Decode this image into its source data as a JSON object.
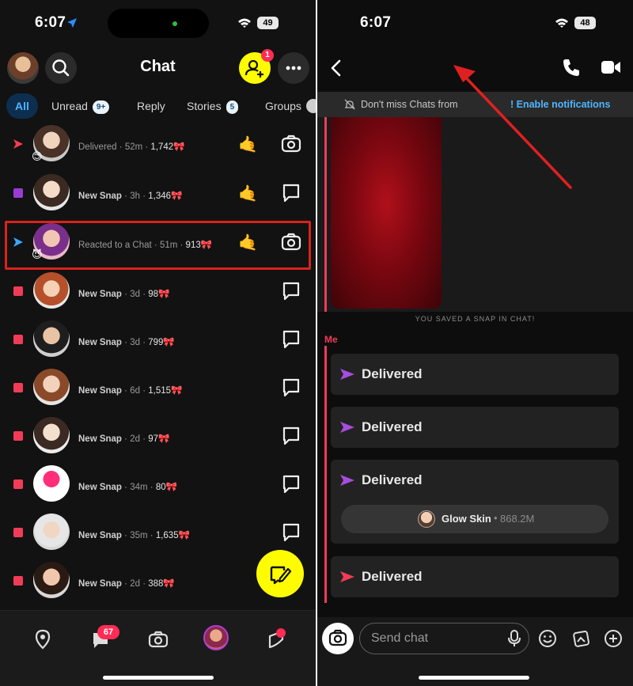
{
  "left": {
    "status": {
      "time": "6:07",
      "battery": "49"
    },
    "header": {
      "title": "Chat",
      "friend_requests_badge": "1"
    },
    "tabs": [
      {
        "label": "All",
        "count": ""
      },
      {
        "label": "Unread",
        "count": "9+"
      },
      {
        "label": "Reply",
        "count": ""
      },
      {
        "label": "Stories",
        "count": "5"
      },
      {
        "label": "Groups",
        "count": ""
      }
    ],
    "chats": [
      {
        "indicator": "sent-snap-red",
        "status": "Delivered",
        "time": "52m",
        "streak": "1,742🎀",
        "action": "camera-icon",
        "wave": true,
        "emoji_badge": "😊"
      },
      {
        "indicator": "new-snap-purple",
        "status": "New Snap",
        "time": "3h",
        "streak": "1,346🎀",
        "action": "chat-bubble-icon",
        "wave": true,
        "emoji_badge": ""
      },
      {
        "indicator": "sent-chat-blue",
        "status": "Reacted to a Chat",
        "time": "51m",
        "streak": "913🎀",
        "action": "camera-icon",
        "wave": true,
        "emoji_badge": "😈"
      },
      {
        "indicator": "new-snap-red",
        "status": "New Snap",
        "time": "3d",
        "streak": "98🎀",
        "action": "chat-bubble-icon",
        "wave": false,
        "emoji_badge": ""
      },
      {
        "indicator": "new-snap-red",
        "status": "New Snap",
        "time": "3d",
        "streak": "799🎀",
        "action": "chat-bubble-icon",
        "wave": false,
        "emoji_badge": ""
      },
      {
        "indicator": "new-snap-red",
        "status": "New Snap",
        "time": "6d",
        "streak": "1,515🎀",
        "action": "chat-bubble-icon",
        "wave": false,
        "emoji_badge": ""
      },
      {
        "indicator": "new-snap-red",
        "status": "New Snap",
        "time": "2d",
        "streak": "97🎀",
        "action": "chat-bubble-icon",
        "wave": false,
        "emoji_badge": ""
      },
      {
        "indicator": "new-snap-red",
        "status": "New Snap",
        "time": "34m",
        "streak": "80🎀",
        "action": "chat-bubble-icon",
        "wave": false,
        "emoji_badge": ""
      },
      {
        "indicator": "new-snap-red",
        "status": "New Snap",
        "time": "35m",
        "streak": "1,635🎀",
        "action": "chat-bubble-icon",
        "wave": false,
        "emoji_badge": ""
      },
      {
        "indicator": "new-snap-red",
        "status": "New Snap",
        "time": "2d",
        "streak": "388🎀",
        "action": "",
        "wave": false,
        "emoji_badge": ""
      }
    ],
    "bottom_nav": {
      "chat_badge": "67"
    },
    "colors": {
      "accent_yellow": "#fffc00",
      "snap_red": "#f23c57",
      "purple": "#9b3bd6",
      "blue": "#3aa7ff",
      "highlight_red": "#d8231c"
    }
  },
  "right": {
    "status": {
      "time": "6:07",
      "battery": "48"
    },
    "notice": {
      "text": "Don't miss Chats from",
      "link": "! Enable notifications"
    },
    "saved_label": "YOU SAVED A SNAP IN CHAT!",
    "sender_label": "Me",
    "messages": [
      {
        "label": "Delivered",
        "type": "chat"
      },
      {
        "label": "Delivered",
        "type": "chat"
      },
      {
        "label": "Delivered",
        "type": "chat",
        "lens": {
          "name": "Glow Skin",
          "views": "868.2M"
        }
      },
      {
        "label": "Delivered",
        "type": "snap"
      }
    ],
    "composer": {
      "placeholder": "Send chat"
    }
  }
}
